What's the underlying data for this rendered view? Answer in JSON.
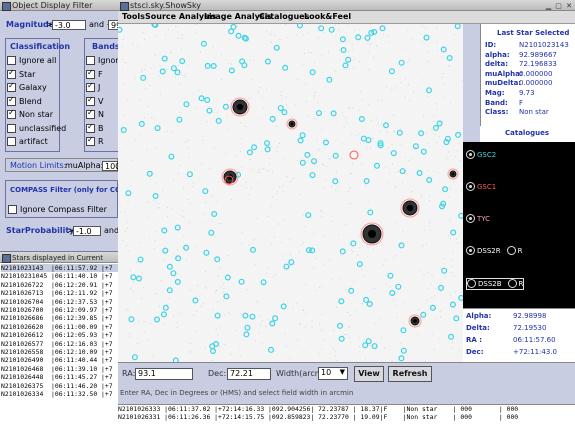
{
  "filter_window": {
    "title": "Object Display Filter",
    "magnitude_label": "Magnitude",
    "mag_op": ">",
    "mag_min": "-3.0",
    "mag_and": "and <",
    "mag_max": "99",
    "classification_title": "Classification",
    "classification_items": [
      {
        "label": "Ignore all",
        "checked": false
      },
      {
        "label": "Star",
        "checked": true
      },
      {
        "label": "Galaxy",
        "checked": true
      },
      {
        "label": "Blend",
        "checked": true
      },
      {
        "label": "Non star",
        "checked": true
      },
      {
        "label": "unclassified",
        "checked": false
      },
      {
        "label": "artifact",
        "checked": false
      }
    ],
    "bands_title": "Bands",
    "bands_items": [
      {
        "label": "Ignore all",
        "checked": false
      },
      {
        "label": "F",
        "checked": true
      },
      {
        "label": "J",
        "checked": true
      },
      {
        "label": "V",
        "checked": true
      },
      {
        "label": "N",
        "checked": true
      },
      {
        "label": "B",
        "checked": true
      },
      {
        "label": "R",
        "checked": true
      }
    ],
    "motion_label": "Motion Limits:",
    "mu_alpha_label": "muAlpha:",
    "mu_alpha_value": "100",
    "compass_title": "COMPASS Filter (only for COMPASS",
    "ignore_compass_label": "Ignore Compass Filter",
    "starprob_label": "StarProbability",
    "starprob_op": ">",
    "starprob_value": "-1.0",
    "starprob_and": "and"
  },
  "stars_window": {
    "title": "Stars displayed in Current Field",
    "rows": [
      "N2101023143  |06:11:57.92 |+7",
      "N21010231045 |06:11:40.10 |+7",
      "N2101026722  |06:12:20.91 |+7",
      "N2101026713  |06:12:11.92 |+7",
      "N2101026704  |06:12:37.53 |+7",
      "N2101026700  |06:12:09.97 |+7",
      "N2101026686  |06:12:39.85 |+7",
      "N2101026620  |06:11:00.09 |+7",
      "N2101026612  |06:12:05.93 |+7",
      "N2101026577  |06:12:16.03 |+7",
      "N2101026558  |06:12:10.09 |+7",
      "N2101026490  |06:11:40.44 |+7",
      "N2101026468  |06:11:39.10 |+7",
      "N2101026448  |06:11:45.27 |+7",
      "N2101026375  |06:11:46.20 |+7",
      "N2101026334  |06:11:32.50 |+7"
    ]
  },
  "main_window": {
    "title": "stsci.sky.ShowSky",
    "menus": [
      "Tools",
      "Source Analysis",
      "Image Analysis",
      "Catalogues",
      "Look&Feel"
    ],
    "ra_label": "RA:",
    "ra_value": "93.1",
    "dec_label": "Dec:",
    "dec_value": "72.21",
    "width_label": "Width(arcmin):",
    "width_value": "10",
    "view_label": "View",
    "refresh_label": "Refresh",
    "hint": "Enter RA, Dec in Degrees or (HMS) and select field width in arcmin",
    "console_rows": [
      "N2101026333 |06:11:37.02 |+72:14:16.33 |092.904256| 72.23787 | 18.37|F    |Non star    | 000       | 000",
      "N2101026331 |06:11:26.36 |+72:14:15.75 |092.859823| 72.23770 | 19.09|F    |Non star    | 000       | 000"
    ]
  },
  "last_star": {
    "title": "Last Star Selected",
    "fields": [
      {
        "k": "ID:",
        "v": "N2101023143"
      },
      {
        "k": "alpha:",
        "v": "92.989667"
      },
      {
        "k": "delta:",
        "v": "72.196833"
      },
      {
        "k": "muAlpha:",
        "v": "0.000000"
      },
      {
        "k": "muDelta:",
        "v": "0.000000"
      },
      {
        "k": "Mag:",
        "v": "9.73"
      },
      {
        "k": "Band:",
        "v": "F"
      },
      {
        "k": "Class:",
        "v": "Non star"
      }
    ]
  },
  "catalogues": {
    "title": "Catalogues",
    "items": [
      {
        "label": "GSC2",
        "color": "#3ad3e6",
        "selected": true
      },
      {
        "label": "GSC1",
        "color": "#ff5555",
        "selected": true
      },
      {
        "label": "TYC",
        "color": "#ff9a9a",
        "selected": true
      },
      {
        "label": "DSS2R",
        "color": "#ffffff",
        "selected": true,
        "extra": "R"
      },
      {
        "label": "DSS2B",
        "color": "#ffffff",
        "selected": false,
        "extra": "R"
      }
    ]
  },
  "coords": {
    "fields": [
      {
        "k": "Alpha:",
        "v": "92.98998"
      },
      {
        "k": "Delta:",
        "v": "72.19530"
      },
      {
        "k": "RA :",
        "v": "06:11:57.60"
      },
      {
        "k": "Dec:",
        "v": "+72:11:43.0"
      }
    ]
  },
  "colors": {
    "panel": "#c9cde2",
    "accent_blue": "#2233aa",
    "gsc2": "#3ad3e6",
    "gsc1": "#ff5555"
  }
}
